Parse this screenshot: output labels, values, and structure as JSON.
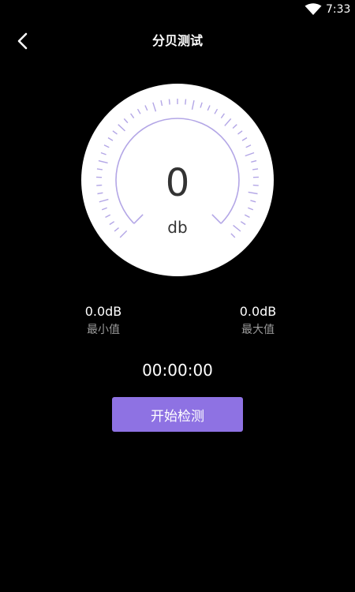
{
  "status_bar": {
    "time": "7:33",
    "icons": [
      "wifi-icon"
    ]
  },
  "header": {
    "back_icon": "chevron-left-icon",
    "title": "分贝测试"
  },
  "gauge": {
    "value": "0",
    "unit": "db",
    "level_fraction": 0,
    "tick_color": "#b3a6e6",
    "face_color": "#ffffff"
  },
  "stats": {
    "min": {
      "value": "0.0dB",
      "label": "最小值"
    },
    "max": {
      "value": "0.0dB",
      "label": "最大值"
    }
  },
  "timer": "00:00:00",
  "action": {
    "start_label": "开始检测",
    "color": "#8e72e3"
  },
  "colors": {
    "background": "#000000",
    "accent": "#8e72e3",
    "muted_text": "#9a9a9a"
  }
}
